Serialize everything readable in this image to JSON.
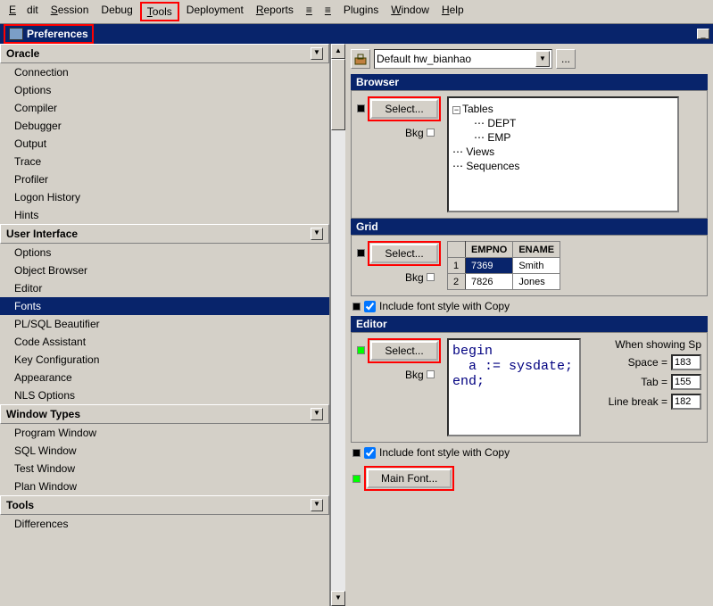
{
  "menu": {
    "edit": "Edit",
    "session": "Session",
    "debug": "Debug",
    "tools": "Tools",
    "deployment": "Deployment",
    "reports": "Reports",
    "macro": "Macro",
    "documents": "Documents",
    "plugins": "Plugins",
    "window": "Window",
    "help": "Help"
  },
  "pref_tab": "Preferences",
  "categories": [
    {
      "name": "Oracle",
      "header": true
    },
    {
      "name": "Connection"
    },
    {
      "name": "Options"
    },
    {
      "name": "Compiler"
    },
    {
      "name": "Debugger"
    },
    {
      "name": "Output"
    },
    {
      "name": "Trace"
    },
    {
      "name": "Profiler"
    },
    {
      "name": "Logon History"
    },
    {
      "name": "Hints"
    },
    {
      "name": "User Interface",
      "header": true
    },
    {
      "name": "Options"
    },
    {
      "name": "Object Browser"
    },
    {
      "name": "Editor"
    },
    {
      "name": "Fonts",
      "selected": true
    },
    {
      "name": "PL/SQL Beautifier"
    },
    {
      "name": "Code Assistant"
    },
    {
      "name": "Key Configuration"
    },
    {
      "name": "Appearance"
    },
    {
      "name": "NLS Options"
    },
    {
      "name": "Window Types",
      "header": true
    },
    {
      "name": "Program Window"
    },
    {
      "name": "SQL Window"
    },
    {
      "name": "Test Window"
    },
    {
      "name": "Plan Window"
    },
    {
      "name": "Tools",
      "header": true
    },
    {
      "name": "Differences"
    }
  ],
  "combo": {
    "value": "Default hw_bianhao"
  },
  "ellipsis": "...",
  "browser": {
    "title": "Browser",
    "select": "Select...",
    "bkg": "Bkg",
    "tree": {
      "tables": "Tables",
      "dept": "DEPT",
      "emp": "EMP",
      "views": "Views",
      "sequences": "Sequences"
    }
  },
  "grid": {
    "title": "Grid",
    "select": "Select...",
    "bkg": "Bkg",
    "headers": {
      "empno": "EMPNO",
      "ename": "ENAME"
    },
    "rows": [
      {
        "n": "1",
        "empno": "7369",
        "ename": "Smith"
      },
      {
        "n": "2",
        "empno": "7826",
        "ename": "Jones"
      }
    ],
    "include": "Include font style with Copy"
  },
  "editor": {
    "title": "Editor",
    "select": "Select...",
    "bkg": "Bkg",
    "code": "begin\n  a := sysdate;\nend;",
    "showing": "When showing Sp",
    "space_lbl": "Space =",
    "space_val": "183",
    "tab_lbl": "Tab =",
    "tab_val": "155",
    "lb_lbl": "Line break =",
    "lb_val": "182",
    "include": "Include font style with Copy",
    "mainfont": "Main Font..."
  }
}
